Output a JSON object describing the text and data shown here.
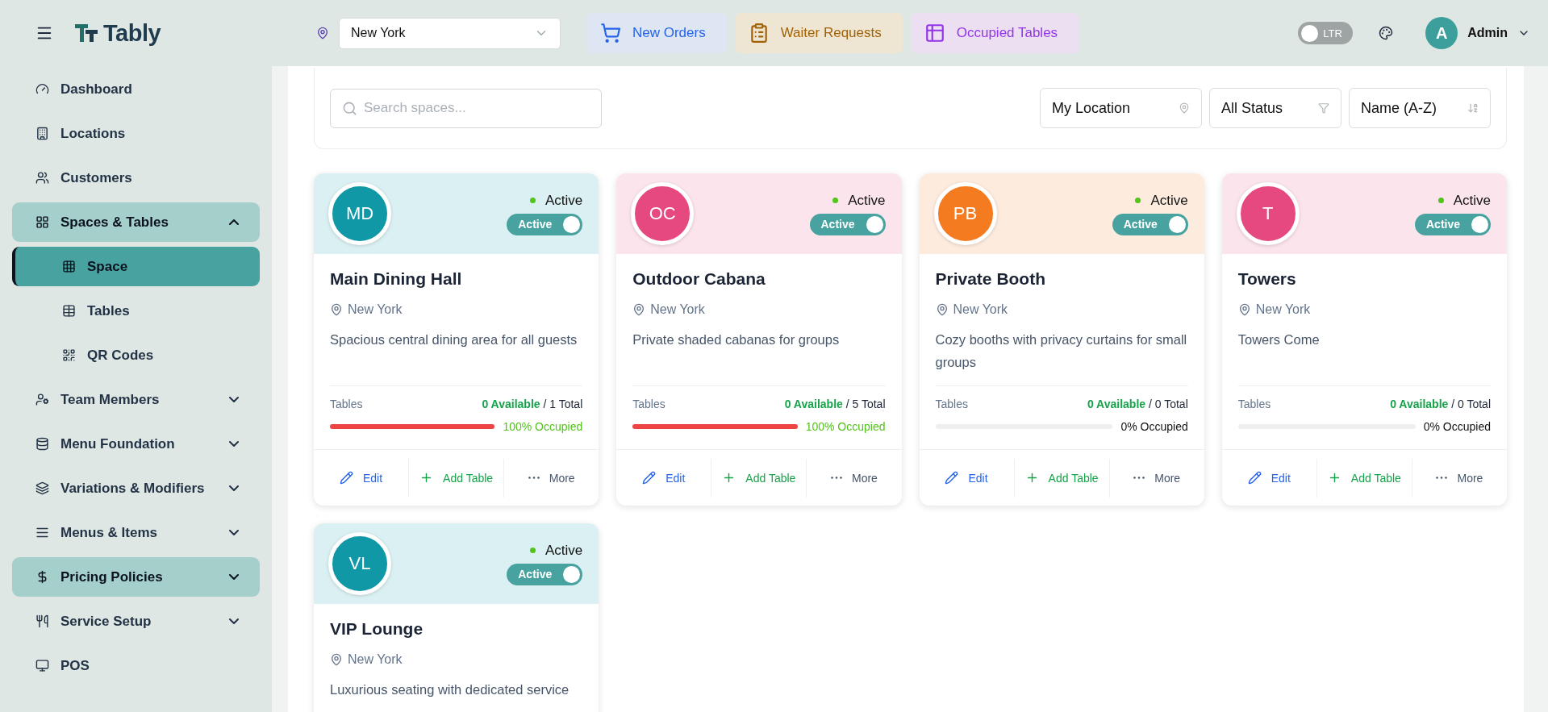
{
  "header": {
    "location": "New York",
    "quick_actions": [
      {
        "label": "New Orders",
        "color": "#2563eb"
      },
      {
        "label": "Waiter Requests",
        "color": "#a16207"
      },
      {
        "label": "Occupied Tables",
        "color": "#9333ea"
      }
    ],
    "direction_toggle": {
      "label": "LTR",
      "on": false
    },
    "user": {
      "initial": "A",
      "name": "Admin"
    },
    "brand": "Tably"
  },
  "sidebar": {
    "items": [
      {
        "label": "Dashboard",
        "selected": false
      },
      {
        "label": "Locations",
        "selected": false
      },
      {
        "label": "Customers",
        "selected": false
      },
      {
        "label": "Spaces & Tables",
        "selected": true,
        "expanded": true,
        "children": [
          {
            "label": "Space",
            "selected": true
          },
          {
            "label": "Tables",
            "selected": false
          },
          {
            "label": "QR Codes",
            "selected": false
          }
        ]
      },
      {
        "label": "Team Members",
        "selected": false,
        "expanded": false
      },
      {
        "label": "Menu Foundation",
        "selected": false,
        "expanded": false
      },
      {
        "label": "Variations & Modifiers",
        "selected": false,
        "expanded": false
      },
      {
        "label": "Menus & Items",
        "selected": false,
        "expanded": false
      },
      {
        "label": "Pricing Policies",
        "selected": true,
        "expanded": false
      },
      {
        "label": "Service Setup",
        "selected": false,
        "expanded": false
      },
      {
        "label": "POS",
        "selected": false
      }
    ]
  },
  "filters": {
    "search_placeholder": "Search spaces...",
    "selects": [
      "My Location",
      "All Status",
      "Name (A-Z)"
    ]
  },
  "spaces": [
    {
      "initials": "MD",
      "color": "#1098a6",
      "status": "Active",
      "toggle": {
        "label": "Active",
        "on": true
      },
      "name": "Main Dining Hall",
      "location": "New York",
      "description": "Spacious central dining area for all guests",
      "tables_label": "Tables",
      "available": "0 Available",
      "total": "/ 1 Total",
      "level": 1,
      "occupancy": "100% Occupied",
      "actions": [
        "Edit",
        "Add Table",
        "More"
      ]
    },
    {
      "initials": "OC",
      "color": "#e64980",
      "status": "Active",
      "toggle": {
        "label": "Active",
        "on": true
      },
      "name": "Outdoor Cabana",
      "location": "New York",
      "description": "Private shaded cabanas for groups",
      "tables_label": "Tables",
      "available": "0 Available",
      "total": "/ 5 Total",
      "level": 1,
      "occupancy": "100% Occupied",
      "actions": [
        "Edit",
        "Add Table",
        "More"
      ]
    },
    {
      "initials": "PB",
      "color": "#f47b20",
      "status": "Active",
      "toggle": {
        "label": "Active",
        "on": true
      },
      "name": "Private Booth",
      "location": "New York",
      "description": "Cozy booths with privacy curtains for small groups",
      "tables_label": "Tables",
      "available": "0 Available",
      "total": "/ 0 Total",
      "level": 0,
      "occupancy": "0% Occupied",
      "actions": [
        "Edit",
        "Add Table",
        "More"
      ]
    },
    {
      "initials": "T",
      "color": "#e64980",
      "status": "Active",
      "toggle": {
        "label": "Active",
        "on": true
      },
      "name": "Towers",
      "location": "New York",
      "description": "Towers Come",
      "tables_label": "Tables",
      "available": "0 Available",
      "total": "/ 0 Total",
      "level": 0,
      "occupancy": "0% Occupied",
      "actions": [
        "Edit",
        "Add Table",
        "More"
      ]
    },
    {
      "initials": "VL",
      "color": "#1098a6",
      "status": "Active",
      "toggle": {
        "label": "Active",
        "on": true
      },
      "name": "VIP Lounge",
      "location": "New York",
      "description": "Luxurious seating with dedicated service"
    }
  ]
}
